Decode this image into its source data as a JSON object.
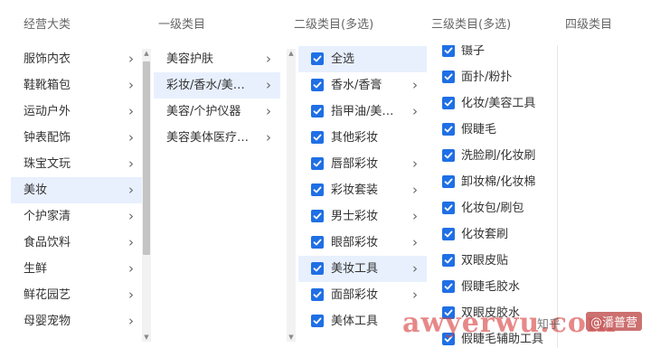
{
  "headers": [
    "经营大类",
    "一级类目",
    "二级类目(多选)",
    "三级类目(多选)",
    "四级类目"
  ],
  "col1": [
    {
      "label": "服饰内衣",
      "selected": false
    },
    {
      "label": "鞋靴箱包",
      "selected": false
    },
    {
      "label": "运动户外",
      "selected": false
    },
    {
      "label": "钟表配饰",
      "selected": false
    },
    {
      "label": "珠宝文玩",
      "selected": false
    },
    {
      "label": "美妆",
      "selected": true
    },
    {
      "label": "个护家清",
      "selected": false
    },
    {
      "label": "食品饮料",
      "selected": false
    },
    {
      "label": "生鲜",
      "selected": false
    },
    {
      "label": "鲜花园艺",
      "selected": false
    },
    {
      "label": "母婴宠物",
      "selected": false
    }
  ],
  "col2": [
    {
      "label": "美容护肤",
      "selected": false
    },
    {
      "label": "彩妆/香水/美妆工具",
      "selected": true
    },
    {
      "label": "美容/个护仪器",
      "selected": false
    },
    {
      "label": "美容美体医疗器械",
      "selected": false
    }
  ],
  "col3": [
    {
      "label": "全选",
      "checked": true,
      "selected": true,
      "chevron": false
    },
    {
      "label": "香水/香膏",
      "checked": true,
      "selected": false,
      "chevron": true
    },
    {
      "label": "指甲油/美甲工具",
      "checked": true,
      "selected": false,
      "chevron": true
    },
    {
      "label": "其他彩妆",
      "checked": true,
      "selected": false,
      "chevron": false
    },
    {
      "label": "唇部彩妆",
      "checked": true,
      "selected": false,
      "chevron": true
    },
    {
      "label": "彩妆套装",
      "checked": true,
      "selected": false,
      "chevron": true
    },
    {
      "label": "男士彩妆",
      "checked": true,
      "selected": false,
      "chevron": true
    },
    {
      "label": "眼部彩妆",
      "checked": true,
      "selected": false,
      "chevron": true
    },
    {
      "label": "美妆工具",
      "checked": true,
      "selected": true,
      "chevron": true
    },
    {
      "label": "面部彩妆",
      "checked": true,
      "selected": false,
      "chevron": true
    },
    {
      "label": "美体工具",
      "checked": true,
      "selected": false,
      "chevron": false
    }
  ],
  "col4": [
    {
      "label": "镊子",
      "checked": true
    },
    {
      "label": "面扑/粉扑",
      "checked": true
    },
    {
      "label": "化妆/美容工具",
      "checked": true
    },
    {
      "label": "假睫毛",
      "checked": true
    },
    {
      "label": "洗脸刷/化妆刷",
      "checked": true
    },
    {
      "label": "卸妆棉/化妆棉",
      "checked": true
    },
    {
      "label": "化妆包/刷包",
      "checked": true
    },
    {
      "label": "化妆套刷",
      "checked": true
    },
    {
      "label": "双眼皮贴",
      "checked": true
    },
    {
      "label": "假睫毛胶水",
      "checked": true
    },
    {
      "label": "双眼皮胶水",
      "checked": true
    },
    {
      "label": "假睫毛辅助工具",
      "checked": true
    }
  ],
  "watermark": "awyerwu.com",
  "zhihu": "知乎",
  "tag": "@潘普营",
  "icons": {
    "chevron": "chevron-right-icon",
    "checkbox": "checkbox-checked-icon"
  },
  "colors": {
    "accent": "#1f6fe5",
    "selected_bg": "#e8f0fe",
    "scroll_thumb": "#c4c4c4"
  }
}
